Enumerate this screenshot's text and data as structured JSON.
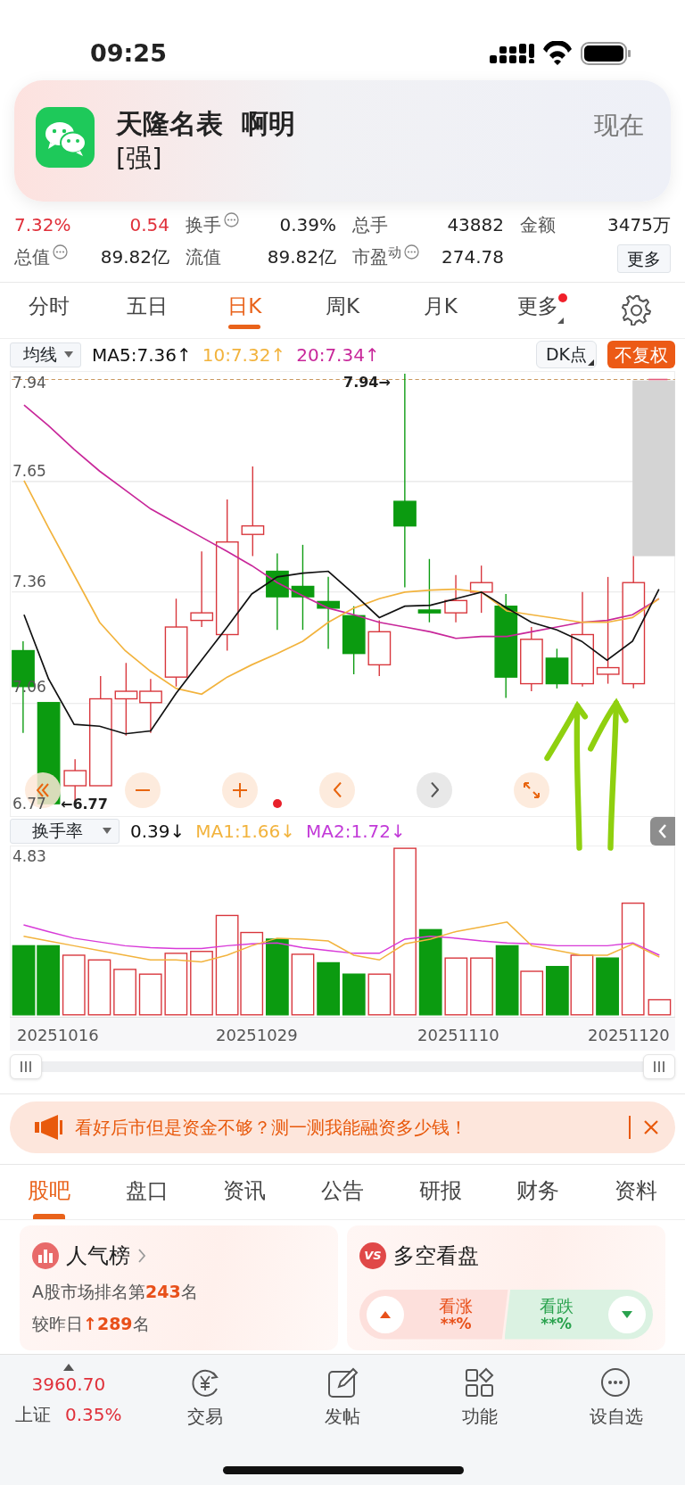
{
  "status_bar": {
    "time": "09:25"
  },
  "notification": {
    "title": "天隆名表  啊明",
    "message": "[强]",
    "time": "现在"
  },
  "stats_rows": [
    [
      {
        "kind": "change",
        "text": "7.32%"
      },
      {
        "kind": "change",
        "text": "0.54"
      },
      {
        "kind": "label",
        "text": "换手",
        "info": true
      },
      {
        "kind": "value",
        "text": "0.39%"
      },
      {
        "kind": "label",
        "text": "总手"
      },
      {
        "kind": "value",
        "text": "43882"
      },
      {
        "kind": "label",
        "text": "金额"
      },
      {
        "kind": "value",
        "text": "3475万"
      }
    ],
    [
      {
        "kind": "label",
        "text": "总值",
        "info": true
      },
      {
        "kind": "value",
        "text": "89.82亿"
      },
      {
        "kind": "label",
        "text": "流值"
      },
      {
        "kind": "value",
        "text": "89.82亿"
      },
      {
        "kind": "label",
        "text": "市盈$^{动}$",
        "info": true
      },
      {
        "kind": "value",
        "text": "274.78"
      },
      {
        "kind": "label",
        "text": ""
      },
      {
        "kind": "button",
        "text": "更多"
      }
    ]
  ],
  "chart_tabs": [
    {
      "label": "分时",
      "selected": false
    },
    {
      "label": "五日",
      "selected": false
    },
    {
      "label": "日K",
      "selected": true
    },
    {
      "label": "周K",
      "selected": false
    },
    {
      "label": "月K",
      "selected": false
    },
    {
      "label": "更多",
      "selected": false,
      "dot": true
    }
  ],
  "ma_bar": {
    "selector": "均线",
    "readings": [
      {
        "text": "MA5:7.36↑",
        "color": "#111111"
      },
      {
        "text": "10:7.32↑",
        "color": "#f2b33d"
      },
      {
        "text": "20:7.34↑",
        "color": "#c8279a"
      }
    ],
    "dk_button": "DK点",
    "adjust_button": "不复权"
  },
  "price_axis": [
    "7.94",
    "7.65",
    "7.36",
    "7.06",
    "6.77"
  ],
  "high_marker": "7.94→",
  "low_marker": "←6.77",
  "chart_controls": [
    {
      "kind": "first",
      "disabled": false
    },
    {
      "kind": "zoom_out",
      "disabled": false
    },
    {
      "kind": "zoom_in",
      "disabled": false
    },
    {
      "kind": "prev",
      "disabled": false
    },
    {
      "kind": "next",
      "disabled": true
    },
    {
      "kind": "fullscreen",
      "disabled": false
    }
  ],
  "indicator_bar": {
    "selector": "换手率",
    "readings": [
      {
        "text": "0.39↓",
        "color": "#111111"
      },
      {
        "text": "MA1:1.66↓",
        "color": "#f2b33d"
      },
      {
        "text": "MA2:1.72↓",
        "color": "#c23ad8"
      }
    ]
  },
  "volume_axis": [
    "4.83"
  ],
  "dates": [
    "20251016",
    "20251029",
    "20251110",
    "20251120"
  ],
  "promo": {
    "text": "看好后市但是资金不够？测一测我能融资多少钱！"
  },
  "content_tabs": [
    {
      "label": "股吧",
      "selected": true
    },
    {
      "label": "盘口",
      "selected": false
    },
    {
      "label": "资讯",
      "selected": false
    },
    {
      "label": "公告",
      "selected": false
    },
    {
      "label": "研报",
      "selected": false
    },
    {
      "label": "财务",
      "selected": false
    },
    {
      "label": "资料",
      "selected": false
    }
  ],
  "popularity": {
    "title": "人气榜",
    "rank": "A股市场排名第**243**名",
    "change": "较昨日**↑289**名"
  },
  "sentiment": {
    "badge": "VS",
    "title": "多空看盘",
    "bull": {
      "label": "看涨",
      "value": "**%"
    },
    "bear": {
      "label": "看跌",
      "value": "**%"
    }
  },
  "bottom_nav": {
    "index": {
      "value": "3960.70",
      "name": "上证",
      "change": "0.35%"
    },
    "items": [
      {
        "kind": "trade",
        "label": "交易"
      },
      {
        "kind": "post",
        "label": "发帖"
      },
      {
        "kind": "apps",
        "label": "功能"
      },
      {
        "kind": "more",
        "label": "设自选"
      }
    ]
  }
}
